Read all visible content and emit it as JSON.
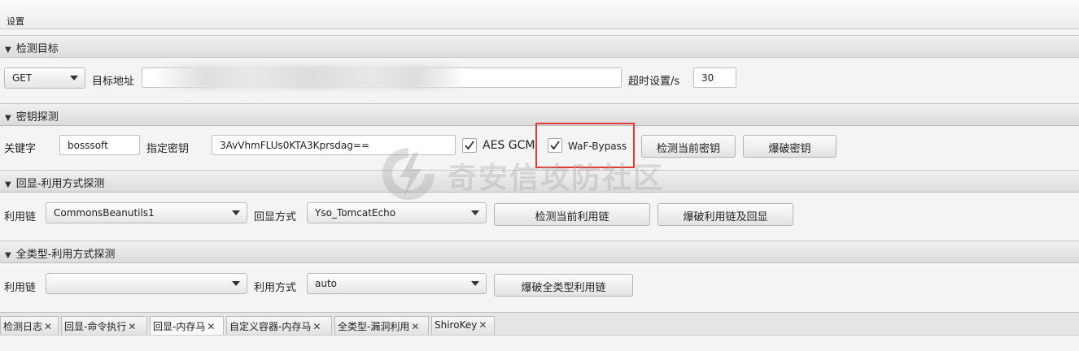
{
  "menu": {
    "settings": "设置"
  },
  "target_section": {
    "title": "检测目标",
    "method": "GET",
    "url_label": "目标地址",
    "url_value": "",
    "timeout_label": "超时设置/s",
    "timeout_value": "30"
  },
  "key_section": {
    "title": "密钥探测",
    "keyword_label": "关键字",
    "keyword_value": "bosssoft",
    "key_label": "指定密钥",
    "key_value": "3AvVhmFLUs0KTA3Kprsdag==",
    "aes_gcm_label": "AES GCM",
    "aes_gcm_checked": true,
    "waf_label": "WaF-Bypass",
    "waf_checked": true,
    "detect_key_button": "检测当前密钥",
    "brute_key_button": "爆破密钥"
  },
  "echo_section": {
    "title": "回显-利用方式探测",
    "chain_label": "利用链",
    "chain_value": "CommonsBeanutils1",
    "echo_mode_label": "回显方式",
    "echo_mode_value": "Yso_TomcatEcho",
    "detect_chain_button": "检测当前利用链",
    "brute_chain_button": "爆破利用链及回显"
  },
  "alltype_section": {
    "title": "全类型-利用方式探测",
    "chain_label": "利用链",
    "chain_value": "",
    "mode_label": "利用方式",
    "mode_value": "auto",
    "brute_all_button": "爆破全类型利用链"
  },
  "tabs": [
    {
      "label": "检测日志"
    },
    {
      "label": "回显-命令执行"
    },
    {
      "label": "回显-内存马"
    },
    {
      "label": "自定义容器-内存马"
    },
    {
      "label": "全类型-漏洞利用"
    },
    {
      "label": "ShiroKey"
    }
  ],
  "tab_close_glyph": "✕",
  "watermark": {
    "text": "奇安信攻防社区"
  },
  "colors": {
    "highlight": "#e53935",
    "panel": "#f4f4f4",
    "header": "#dcdcdc"
  }
}
